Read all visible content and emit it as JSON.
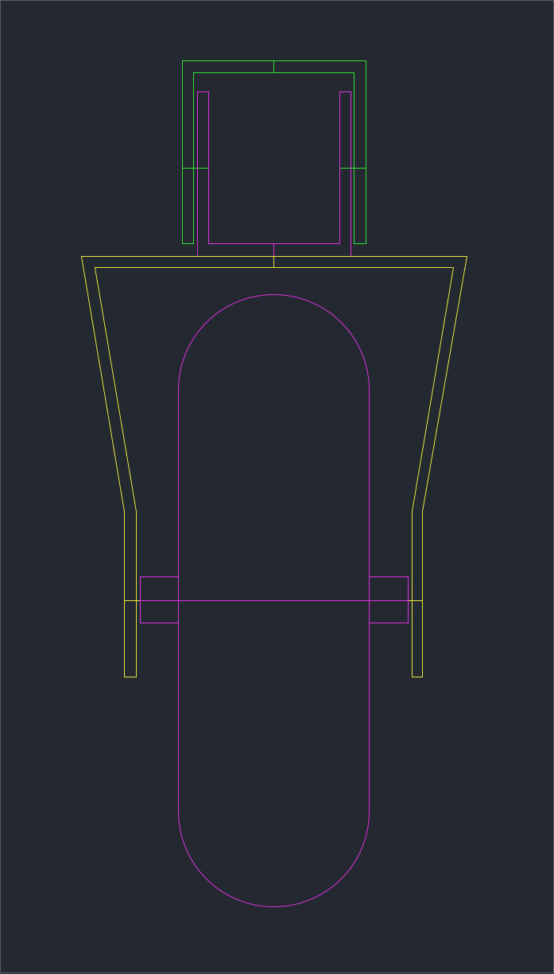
{
  "layers": {
    "bracket": {
      "color": "#33e233",
      "icon": "green-bracket-outline"
    },
    "frame": {
      "color": "#e6e63c",
      "icon": "yellow-fork-frame"
    },
    "parts": {
      "color": "#e033e0",
      "icon": "magenta-wheel-and-axle"
    }
  },
  "background_color": "#232831",
  "border_color": "#5a5f66"
}
